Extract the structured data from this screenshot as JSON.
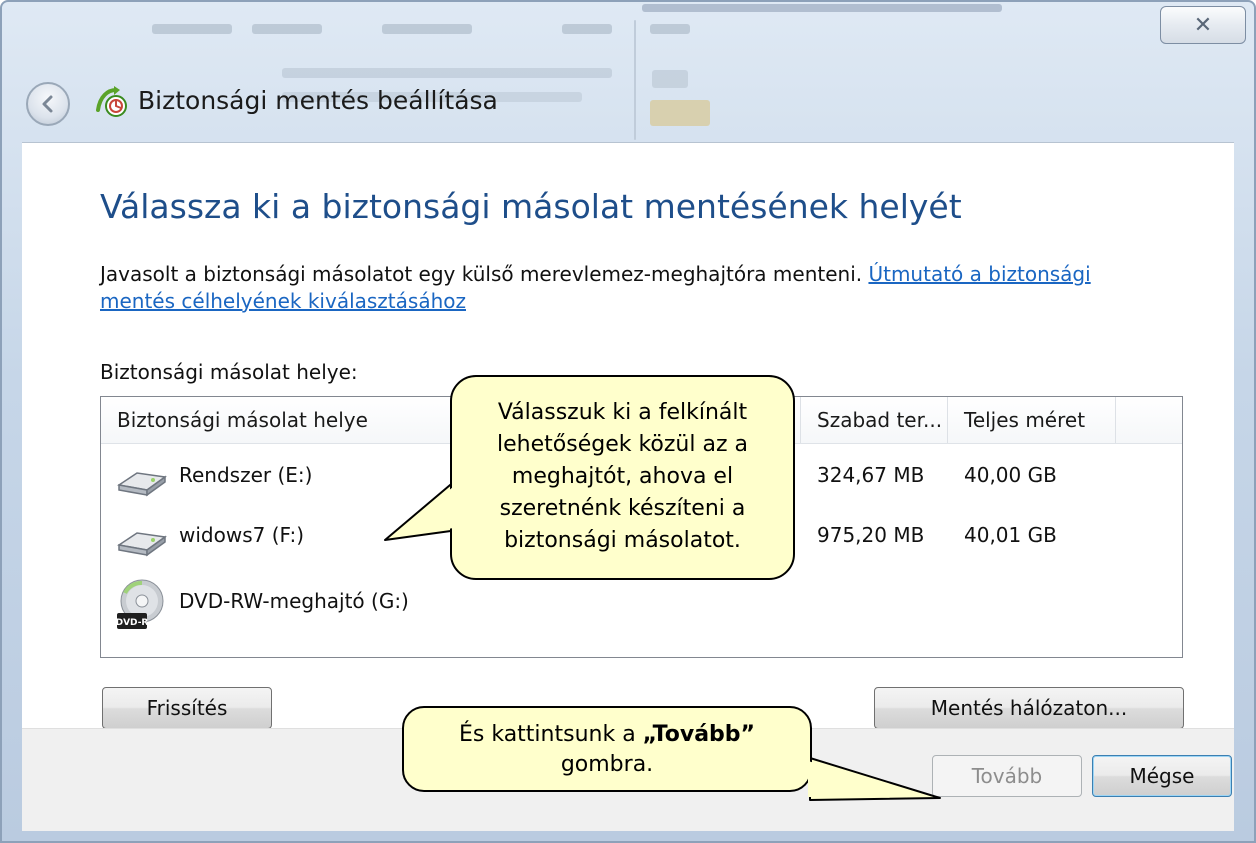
{
  "window": {
    "title": "Biztonsági mentés beállítása",
    "close_glyph": "✕"
  },
  "main": {
    "heading": "Válassza ki a biztonsági másolat mentésének helyét",
    "intro_text": "Javasolt a biztonsági másolatot egy külső merevlemez-meghajtóra menteni.",
    "intro_link": "Útmutató a biztonsági mentés célhelyének kiválasztásához",
    "list_label": "Biztonsági másolat helye:"
  },
  "table": {
    "columns": [
      "Biztonsági másolat helye",
      "Szabad ter...",
      "Teljes méret"
    ],
    "rows": [
      {
        "name": "Rendszer (E:)",
        "free": "324,67 MB",
        "total": "40,00 GB",
        "icon": "hard-drive-icon"
      },
      {
        "name": "widows7 (F:)",
        "free": "975,20 MB",
        "total": "40,01 GB",
        "icon": "hard-drive-icon"
      },
      {
        "name": "DVD-RW-meghajtó (G:)",
        "free": "",
        "total": "",
        "icon": "dvd-drive-icon",
        "icon_label": "DVD-R"
      }
    ]
  },
  "buttons": {
    "refresh": "Frissítés",
    "network": "Mentés hálózaton...",
    "next": "Tovább",
    "cancel": "Mégse"
  },
  "callouts": {
    "top": [
      "Válasszuk ki a felkínált",
      "lehetőségek közül az a",
      "meghajtót, ahova el",
      "szeretnénk készíteni a",
      "biztonsági másolatot."
    ],
    "bottom_prefix": "És kattintsunk a ",
    "bottom_bold": "„Tovább”",
    "bottom_suffix": "gombra."
  },
  "colors": {
    "heading": "#1e4e8a",
    "link": "#1a66c2",
    "callout_fill": "#ffffcc"
  }
}
